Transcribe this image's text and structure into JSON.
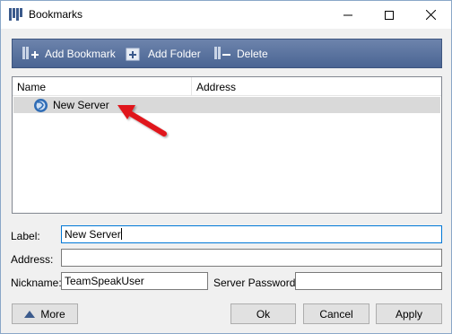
{
  "window": {
    "title": "Bookmarks"
  },
  "toolbar": {
    "add_bookmark": "Add Bookmark",
    "add_folder": "Add Folder",
    "delete": "Delete"
  },
  "list": {
    "columns": [
      "Name",
      "Address"
    ],
    "rows": [
      {
        "name": "New Server",
        "address": "",
        "selected": true
      }
    ]
  },
  "form": {
    "label_label": "Label:",
    "label_value": "New Server",
    "address_label": "Address:",
    "address_value": "",
    "nickname_label": "Nickname:",
    "nickname_value": "TeamSpeakUser",
    "server_password_label": "Server Password:",
    "server_password_value": ""
  },
  "buttons": {
    "more": "More",
    "ok": "Ok",
    "cancel": "Cancel",
    "apply": "Apply"
  },
  "colors": {
    "toolbar": "#4a6593",
    "selection": "#d9d9d9",
    "focus_border": "#0078d7",
    "annotation_arrow": "#e0161b"
  }
}
